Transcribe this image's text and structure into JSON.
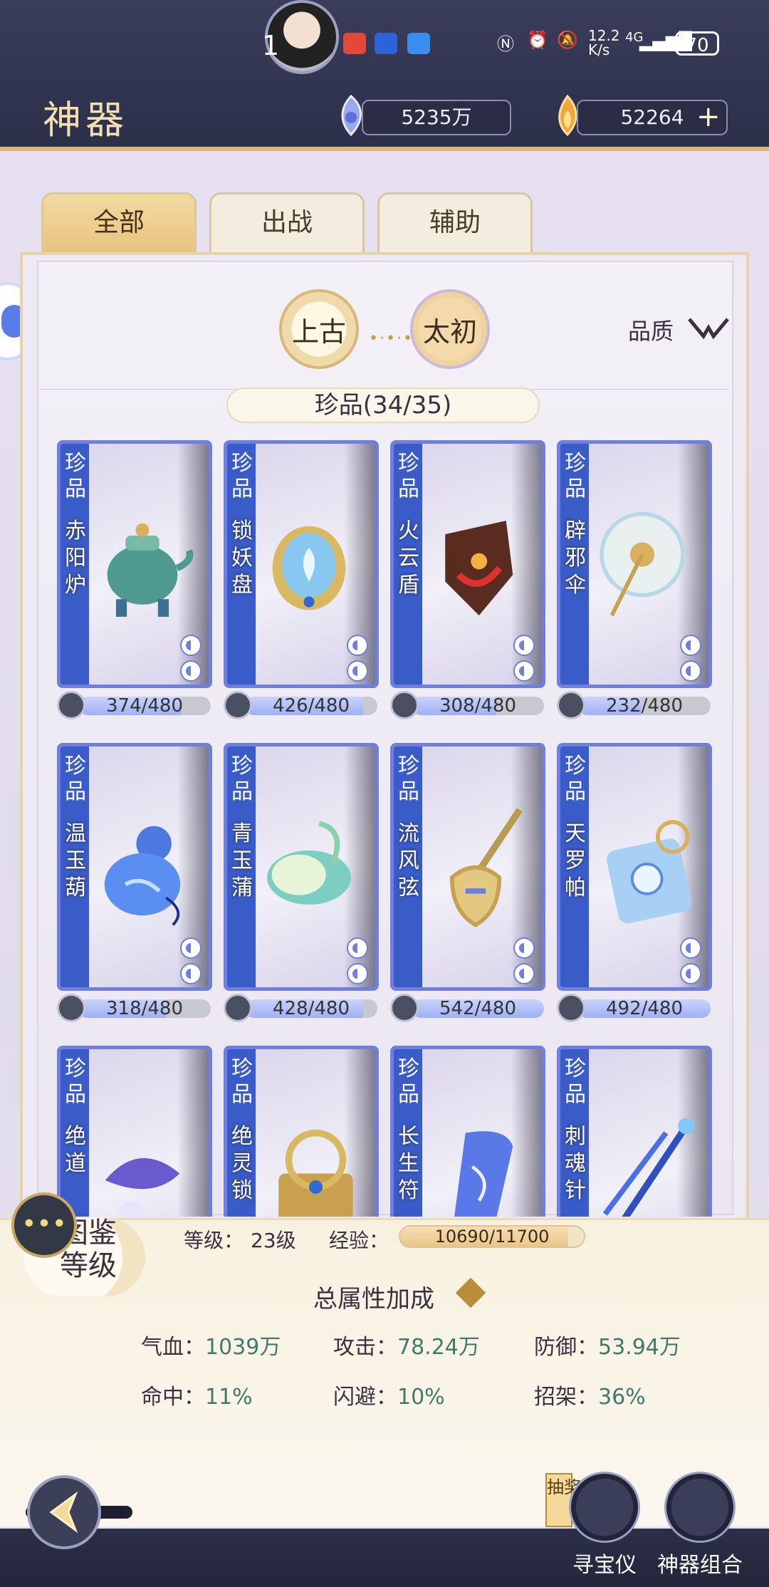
{
  "status_bar": {
    "time": "1",
    "network_speed": "12.2\nK/s",
    "network_type": "4G",
    "battery": "70"
  },
  "header": {
    "title": "神器",
    "currency_1": "5235万",
    "currency_2": "52264",
    "add_label": "+"
  },
  "tabs": [
    {
      "label": "全部",
      "active": true
    },
    {
      "label": "出战",
      "active": false
    },
    {
      "label": "辅助",
      "active": false
    }
  ],
  "era_buttons": [
    {
      "label": "上古",
      "active": true
    },
    {
      "label": "太初",
      "active": false
    }
  ],
  "filter": {
    "label": "品质"
  },
  "section": {
    "label": "珍品(34/35)"
  },
  "cards": [
    {
      "rarity": "珍品",
      "name": "赤阳炉",
      "progress": "374/480",
      "fill": 0.78,
      "art": "teapot"
    },
    {
      "rarity": "珍品",
      "name": "锁妖盘",
      "progress": "426/480",
      "fill": 0.89,
      "art": "mirror"
    },
    {
      "rarity": "珍品",
      "name": "火云盾",
      "progress": "308/480",
      "fill": 0.64,
      "art": "shield"
    },
    {
      "rarity": "珍品",
      "name": "辟邪伞",
      "progress": "232/480",
      "fill": 0.48,
      "art": "umbrella"
    },
    {
      "rarity": "珍品",
      "name": "温玉葫",
      "progress": "318/480",
      "fill": 0.66,
      "art": "gourd"
    },
    {
      "rarity": "珍品",
      "name": "青玉蒲",
      "progress": "428/480",
      "fill": 0.89,
      "art": "drum"
    },
    {
      "rarity": "珍品",
      "name": "流风弦",
      "progress": "542/480",
      "fill": 1.0,
      "art": "pipa"
    },
    {
      "rarity": "珍品",
      "name": "天罗帕",
      "progress": "492/480",
      "fill": 1.0,
      "art": "cloth"
    },
    {
      "rarity": "珍品",
      "name": "绝道",
      "progress": "",
      "fill": 0,
      "art": "ribbon"
    },
    {
      "rarity": "珍品",
      "name": "绝灵锁",
      "progress": "",
      "fill": 0,
      "art": "lock"
    },
    {
      "rarity": "珍品",
      "name": "长生符",
      "progress": "",
      "fill": 0,
      "art": "talisman"
    },
    {
      "rarity": "珍品",
      "name": "刺魂针",
      "progress": "",
      "fill": 0,
      "art": "needle"
    }
  ],
  "level_panel": {
    "badge": "图鉴\n等级",
    "level_label": "等级：",
    "level_value": "23级",
    "exp_label": "经验：",
    "exp_value": "10690/11700",
    "exp_fill": 0.914
  },
  "total_stats": {
    "title": "总属性加成",
    "items": [
      {
        "label": "气血：",
        "value": "1039万"
      },
      {
        "label": "攻击：",
        "value": "78.24万"
      },
      {
        "label": "防御：",
        "value": "53.94万"
      },
      {
        "label": "命中：",
        "value": "11%"
      },
      {
        "label": "闪避：",
        "value": "10%"
      },
      {
        "label": "招架：",
        "value": "36%"
      }
    ]
  },
  "bottom_nav": {
    "draw_tag": "抽奖",
    "treasure_label": "寻宝仪",
    "combo_label": "神器组合"
  }
}
